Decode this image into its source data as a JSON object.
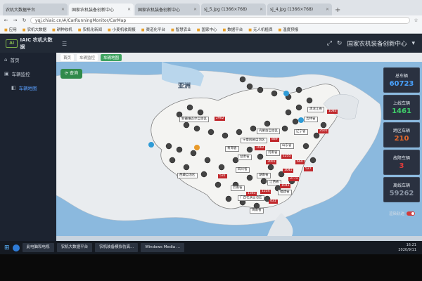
{
  "browser": {
    "tabs": [
      {
        "title": "农机大数据平台",
        "active": false
      },
      {
        "title": "国家农机装备创新中心",
        "active": true
      },
      {
        "title": "国家农机装备创新中心",
        "active": false
      },
      {
        "title": "sj_5.jpg (1366×768)",
        "active": false
      },
      {
        "title": "sj_4.jpg (1366×768)",
        "active": false
      }
    ],
    "new_tab": "+",
    "url": "yqj.chiaic.cn/#/CarRunningMonitor/CarMap",
    "bookmarks": [
      "应用",
      "农机大数据",
      "耕种收机",
      "农机化新闻",
      "小麦机收周报",
      "渠道化平台",
      "智慧农业",
      "国家中心",
      "数据平台",
      "无人机植保",
      "温度预报"
    ]
  },
  "app": {
    "logo_mark": "AI",
    "logo_text": "IAIC 农机大数据",
    "header_title": "国家农机装备创新中心"
  },
  "sidebar": {
    "items": [
      {
        "label": "首页"
      },
      {
        "label": "车辆监控"
      },
      {
        "label": "车辆地图"
      }
    ]
  },
  "breadcrumb": [
    "首页",
    "车辆监控",
    "车辆地图"
  ],
  "map": {
    "query_button": "查询",
    "continent_label": "亚洲",
    "region_tags": [
      "新疆维吾尔自治区",
      "内蒙古自治区",
      "宁夏回族自治区",
      "青海省",
      "甘肃省",
      "四川省",
      "西藏自治区",
      "云南省",
      "广西壮族自治区",
      "湖南省",
      "江西省",
      "河南省",
      "山东省",
      "吉林省",
      "黑龙江省",
      "辽宁省",
      "福建省",
      "海南省"
    ],
    "count_tags": [
      "2902",
      "889",
      "1062",
      "1255",
      "660",
      "527",
      "1041",
      "3771",
      "3001",
      "1042",
      "1254",
      "531",
      "431",
      "1363",
      "1083",
      "3501"
    ]
  },
  "stats": [
    {
      "label": "总车辆",
      "value": "60723",
      "color": "#4aa3ff"
    },
    {
      "label": "上线车辆",
      "value": "1461",
      "color": "#3fd06a"
    },
    {
      "label": "跨区车辆",
      "value": "210",
      "color": "#e8692b"
    },
    {
      "label": "故障车辆",
      "value": "3",
      "color": "#e23a3a"
    },
    {
      "label": "离线车辆",
      "value": "59262",
      "color": "#8a94a3"
    }
  ],
  "live_label": "渲染轨迹",
  "taskbar": {
    "items": [
      "此电脑和电视",
      "农机大数据平台",
      "农机装备模拟仿真...",
      "Windows Media ..."
    ],
    "time": "16:21",
    "date": "2020/9/11"
  }
}
